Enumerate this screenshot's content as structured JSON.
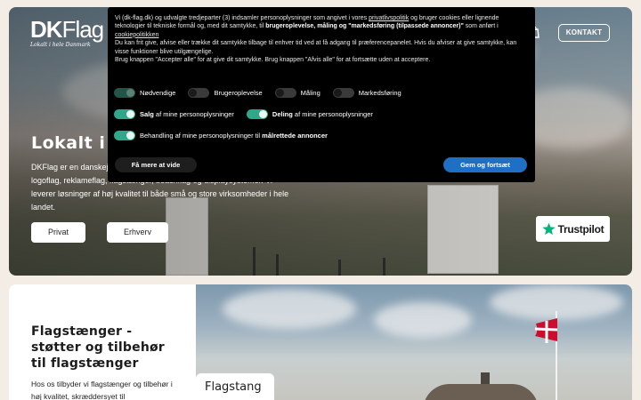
{
  "header": {
    "logo_main": "DK",
    "logo_flag": "Flag",
    "logo_tagline": "Lokalt i hele Danmark",
    "contact_label": "KONTAKT"
  },
  "hero": {
    "title": "Lokalt i hele Danmark",
    "text": "DKFlag er en danskejet virksomhed med speciale i produktion og salg af logoflag, reklameflag, flagstænger, beachflag og displaysystemer. Vi leverer løsninger af høj kvalitet til både små og store virksomheder i hele landet.",
    "btn_privat": "Privat",
    "btn_erhverv": "Erhverv",
    "trustpilot": "Trustpilot"
  },
  "cookie": {
    "line1_pre": "Vi (dk-flag.dk) og udvalgte tredjeparter (3) indsamler personoplysninger som angivet i vores ",
    "privacy_link": "privatlivspolitik",
    "line1_mid": " og bruger cookies eller lignende teknologier til tekniske formål og, med dit samtykke, til ",
    "line1_bold": "brugeroplevelse, måling og \"markedsføring (tilpassede annoncer)\"",
    "line1_post": " som anført i ",
    "cookie_link": "cookiepolitikken",
    "line2": "Du kan frit give, afvise eller trække dit samtykke tilbage til enhver tid ved at få adgang til præferencepanelet. Hvis du afviser at give samtykke, kan visse funktioner blive utilgængelige.",
    "line3": "Brug knappen \"Accepter alle\" for at give dit samtykke. Brug knappen \"Afvis alle\" for at fortsætte uden at acceptere.",
    "toggles": {
      "necessary": "Nødvendige",
      "experience": "Brugeroplevelse",
      "measure": "Måling",
      "marketing": "Markedsføring",
      "sale_bold": "Salg",
      "sale_rest": " af mine personoplysninger",
      "share_bold": "Deling",
      "share_rest": " af mine personoplysninger",
      "targeted_pre": "Behandling af mine personoplysninger til ",
      "targeted_bold": "målrettede annoncer"
    },
    "btn_more": "Få mere at vide",
    "btn_save": "Gem og fortsæt"
  },
  "section2": {
    "title": "Flagstænger - støtter og tilbehør til flagstænger",
    "text": "Hos os tilbyder vi flagstænger og tilbehør i høj kvalitet, skræddersyet til",
    "label": "Flagstang"
  },
  "colors": {
    "accent_blue": "#1f6fc5",
    "toggle_green": "#2fa88a",
    "trustpilot_green": "#00b67a",
    "danish_red": "#c8102e"
  }
}
